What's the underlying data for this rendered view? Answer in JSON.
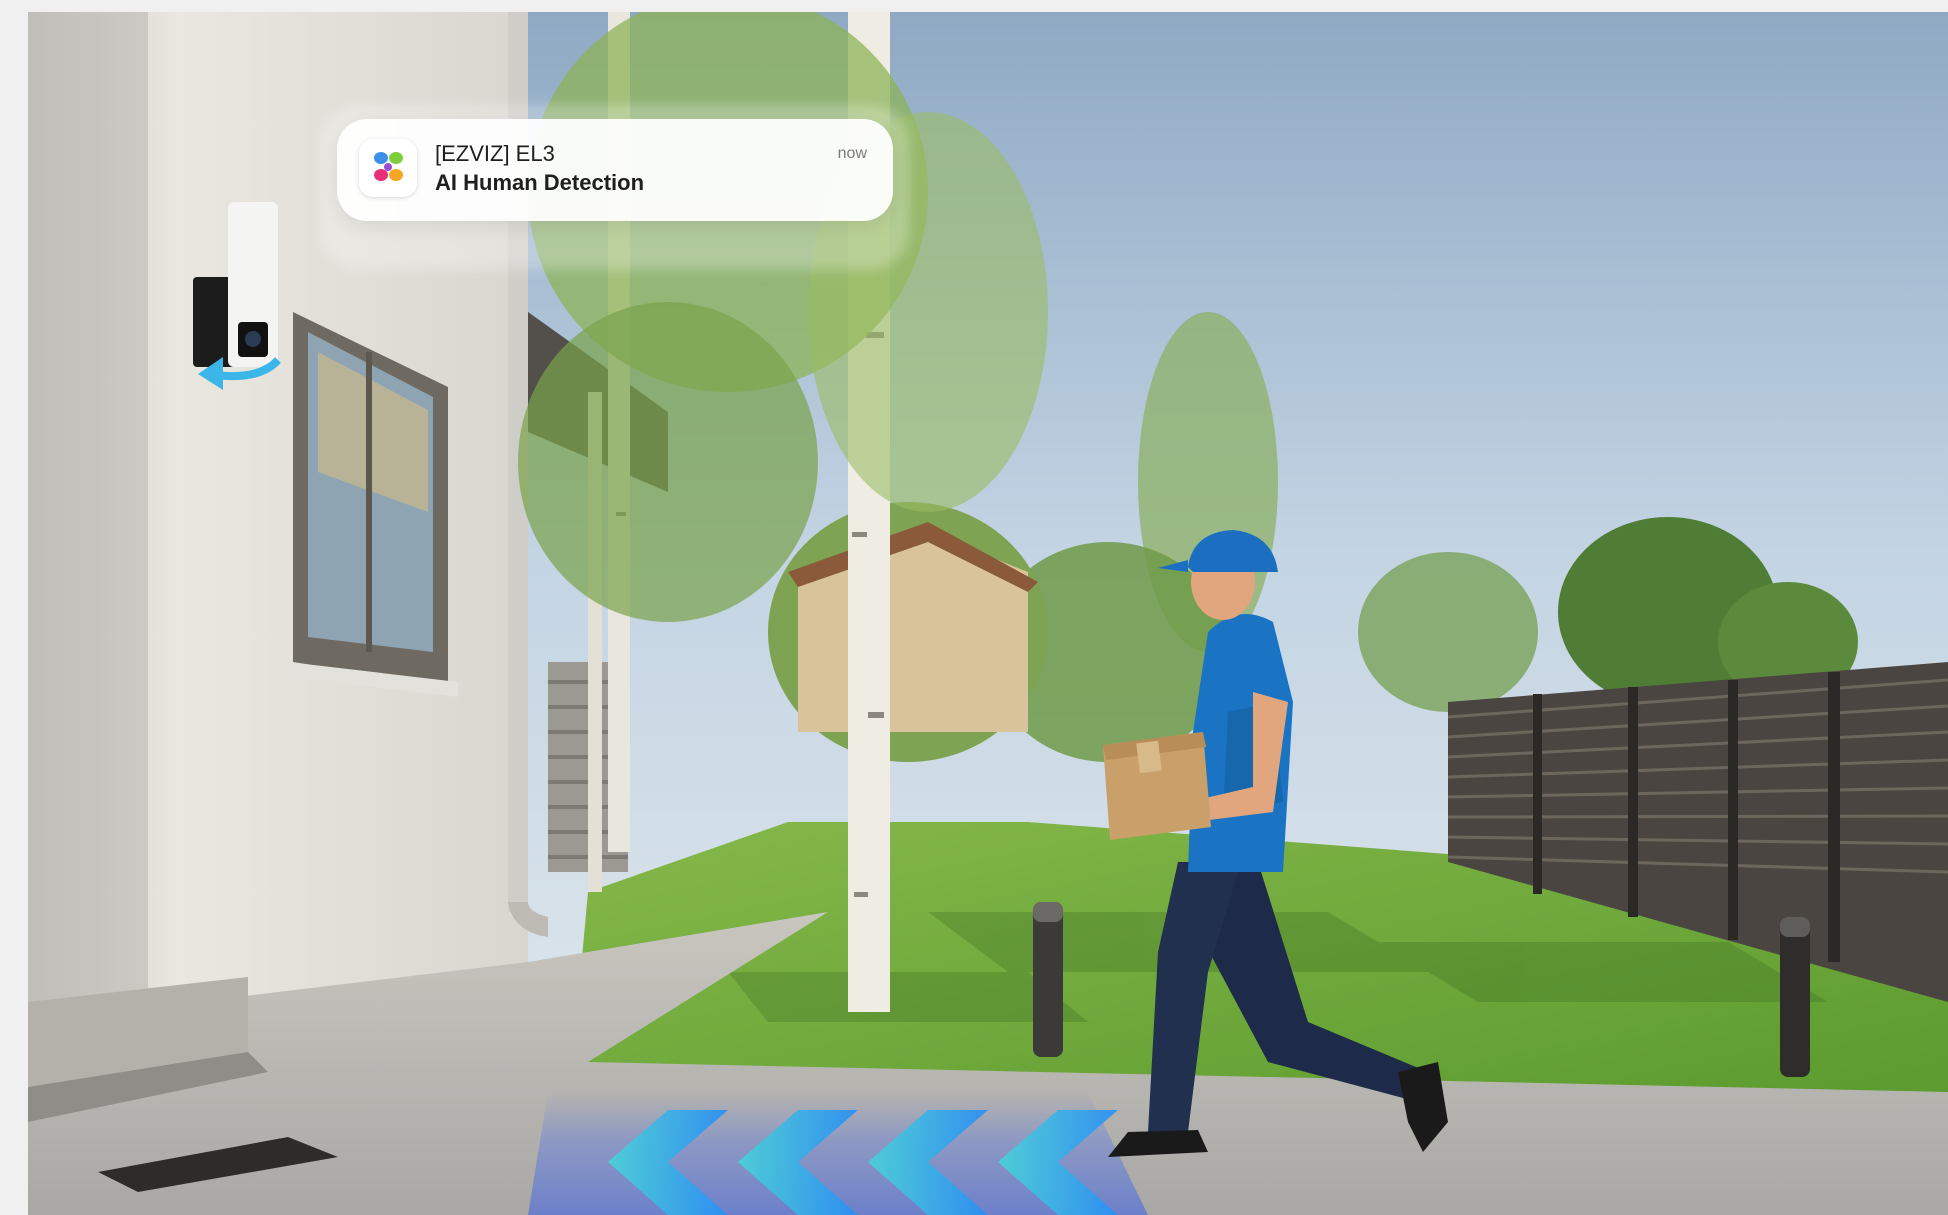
{
  "notification": {
    "title": "[EZVIZ] EL3",
    "body": "AI Human Detection",
    "time": "now",
    "icon": "ezviz-app-icon"
  },
  "colors": {
    "sky": "#b9cde0",
    "wall": "#e8e6e0",
    "grass": "#6fa83a",
    "uniform": "#1a6fb8",
    "arrow": "#35b6f0"
  }
}
